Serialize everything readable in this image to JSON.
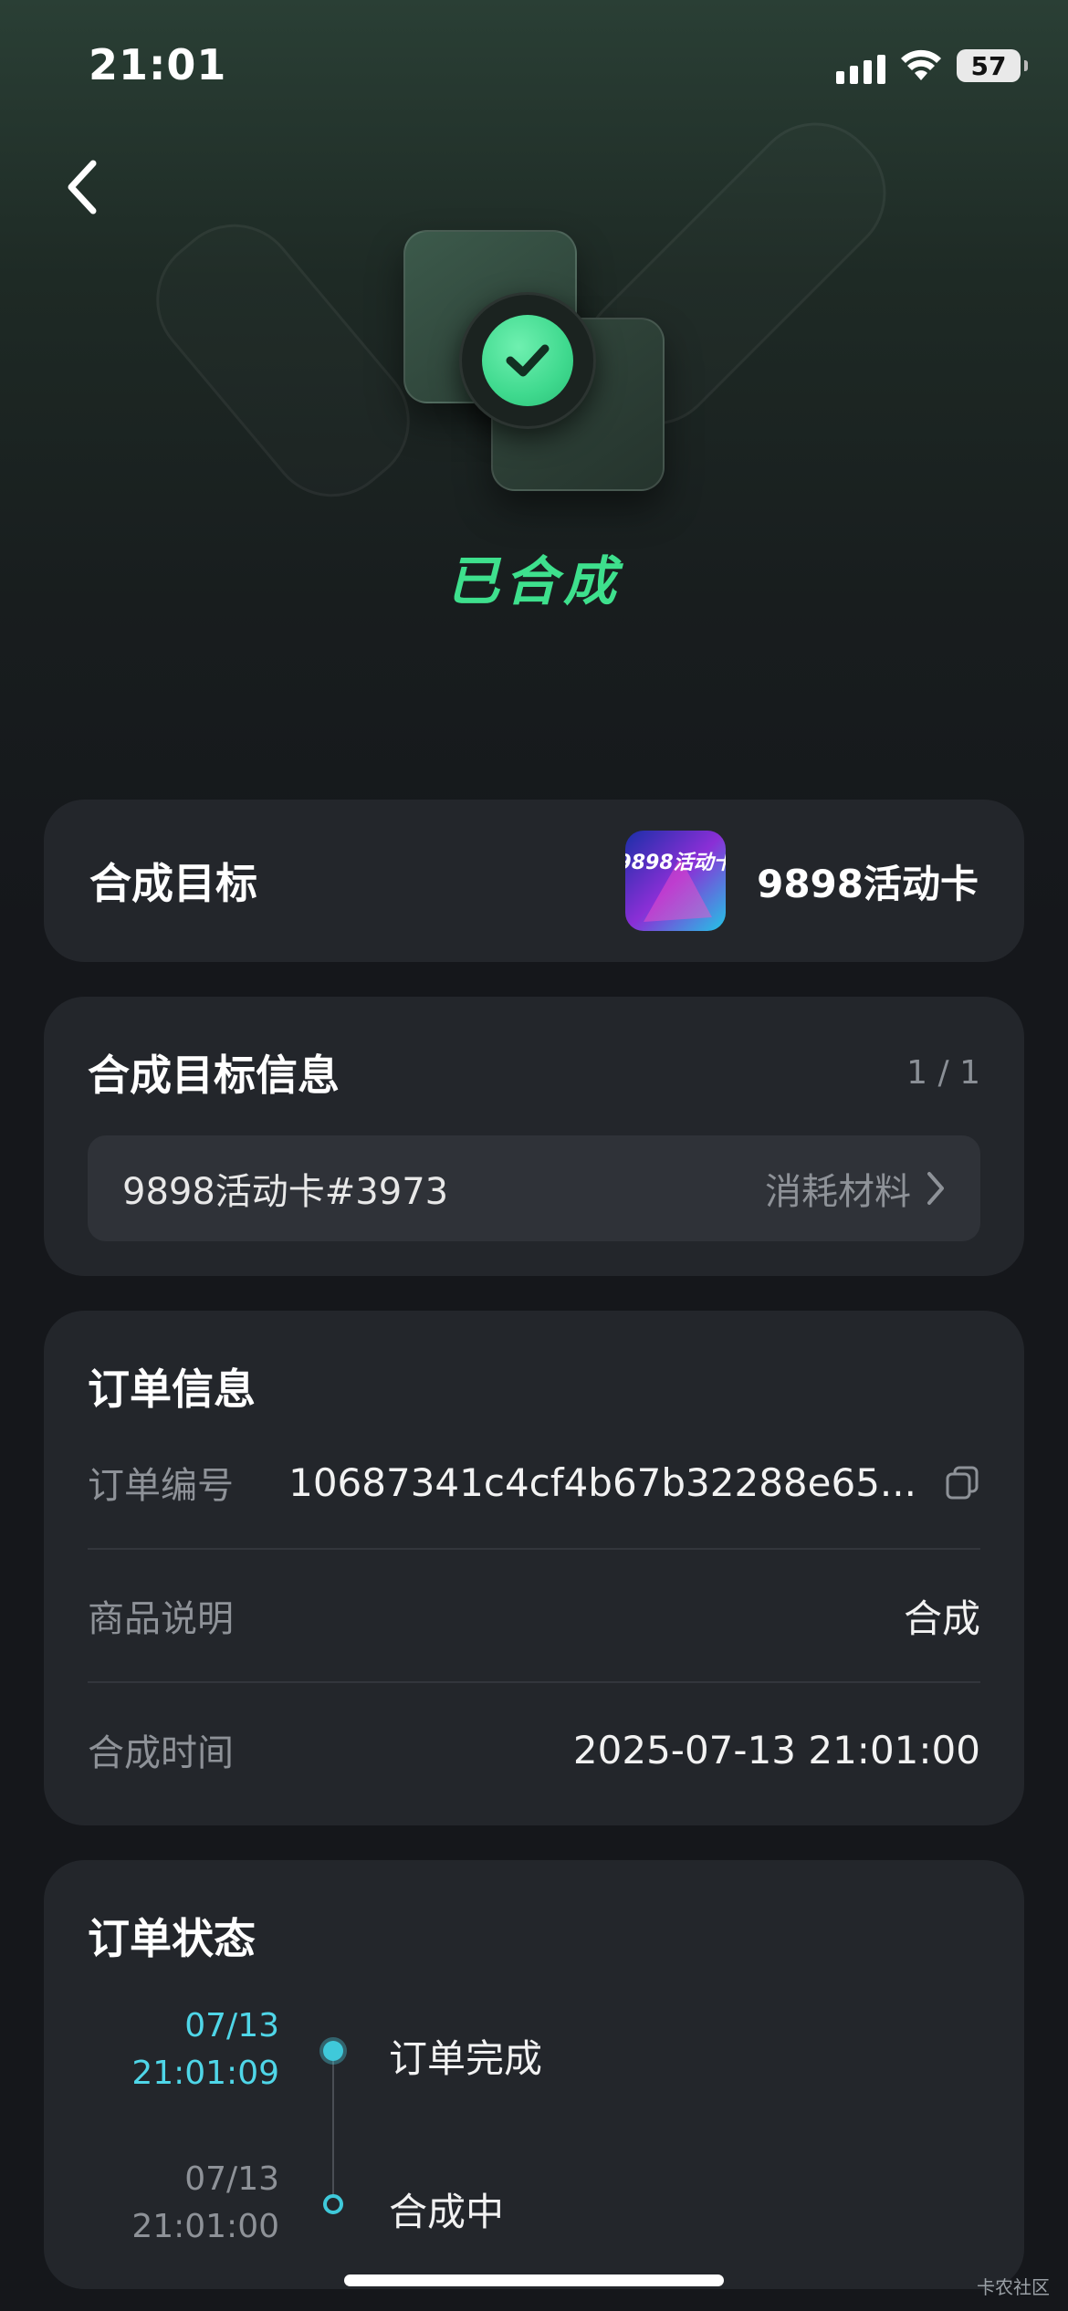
{
  "status_bar": {
    "time": "21:01",
    "battery": "57"
  },
  "hero": {
    "status_title": "已合成",
    "accent_color": "#3ee08d"
  },
  "target": {
    "label": "合成目标",
    "name": "9898活动卡",
    "thumb_text": "9898活动卡"
  },
  "target_info": {
    "title": "合成目标信息",
    "counter": "1 / 1",
    "item_name": "9898活动卡#3973",
    "item_action": "消耗材料"
  },
  "order_info": {
    "title": "订单信息",
    "rows": [
      {
        "label": "订单编号",
        "value": "10687341c4cf4b67b32288e65..."
      },
      {
        "label": "商品说明",
        "value": "合成"
      },
      {
        "label": "合成时间",
        "value": "2025-07-13 21:01:00"
      }
    ]
  },
  "order_status": {
    "title": "订单状态",
    "steps": [
      {
        "date": "07/13",
        "time": "21:01:09",
        "label": "订单完成",
        "active": true
      },
      {
        "date": "07/13",
        "time": "21:01:00",
        "label": "合成中",
        "active": false
      }
    ]
  },
  "watermark": "卡农社区",
  "icons": {
    "back": "chevron-left-icon",
    "check": "check-icon",
    "copy": "copy-icon",
    "chevron_right": "chevron-right-icon"
  }
}
